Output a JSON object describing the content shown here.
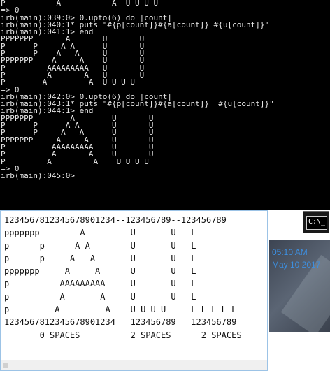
{
  "terminal": {
    "lines": [
      "P           A           A  U U U U",
      "=> 0",
      "irb(main):039:0> 0.upto(6) do |count|",
      "irb(main):040:1* puts \"#{p[count]}#{a[count]} #{u[count]}\"",
      "irb(main):041:1> end",
      "PPPPPPP       A       U       U",
      "P      P     A A      U       U",
      "P      P    A   A     U       U",
      "PPPPPPP    A     A    U       U",
      "P         AAAAAAAAA   U       U",
      "P         A       A   U       U",
      "P        A         A  U U U U",
      "=> 0",
      "irb(main):042:0> 0.upto(6) do |count|",
      "irb(main):043:1* puts \"#{p[count]}#{a[count]}  #{u[count]}\"",
      "irb(main):044:1> end",
      "PPPPPPP        A        U       U",
      "P      P      A A       U       U",
      "P      P     A   A      U       U",
      "PPPPPPP     A     A     U       U",
      "P          AAAAAAAAA    U       U",
      "P          A       A    U       U",
      "P         A         A    U U U U",
      "=> 0",
      "irb(main):045:0>"
    ]
  },
  "editor": {
    "lines": [
      "1234567812345678901234--123456789--123456789",
      "ppppppp        A         U       U   L",
      "p      p      A A        U       U   L",
      "p      p     A   A       U       U   L",
      "ppppppp     A     A      U       U   L",
      "p          AAAAAAAAA     U       U   L",
      "p          A       A     U       U   L",
      "p         A         A    U U U U     L L L L L",
      "1234567812345678901234   123456789   123456789",
      "       0 SPACES          2 SPACES      2 SPACES"
    ]
  },
  "cmd_icon": {
    "label": "C:\\_"
  },
  "clock": {
    "time": "05:10 AM",
    "date": "May 10 2017"
  },
  "colors": {
    "terminal_bg": "#000000",
    "terminal_text": "#e6e6e6",
    "clock_text": "#3d8fe0"
  }
}
